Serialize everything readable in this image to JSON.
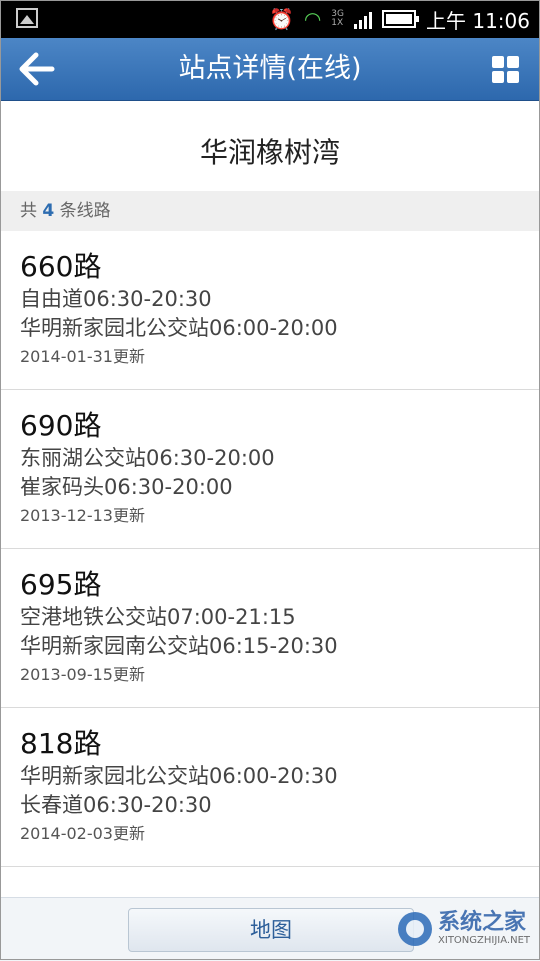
{
  "status_bar": {
    "time": "上午 11:06",
    "network_top": "3G",
    "network_bottom": "1X",
    "icons": [
      "image-icon",
      "alarm-icon",
      "wifi-icon",
      "signal-icon",
      "battery-icon"
    ]
  },
  "header": {
    "title": "站点详情(在线)",
    "back_icon": "back-arrow-icon",
    "menu_icon": "grid-icon",
    "color": "#3a76bb"
  },
  "station": {
    "name": "华润橡树湾"
  },
  "summary": {
    "prefix": "共",
    "count": "4",
    "suffix": "条线路"
  },
  "routes": [
    {
      "name": "660路",
      "line1": "自由道06:30-20:30",
      "line2": "华明新家园北公交站06:00-20:00",
      "updated": "2014-01-31更新"
    },
    {
      "name": "690路",
      "line1": "东丽湖公交站06:30-20:00",
      "line2": "崔家码头06:30-20:00",
      "updated": "2013-12-13更新"
    },
    {
      "name": "695路",
      "line1": "空港地铁公交站07:00-21:15",
      "line2": "华明新家园南公交站06:15-20:30",
      "updated": "2013-09-15更新"
    },
    {
      "name": "818路",
      "line1": "华明新家园北公交站06:00-20:30",
      "line2": "长春道06:30-20:30",
      "updated": "2014-02-03更新"
    }
  ],
  "footer": {
    "map_button": "地图"
  },
  "watermark": {
    "title": "系统之家",
    "url": "XITONGZHIJIA.NET"
  }
}
